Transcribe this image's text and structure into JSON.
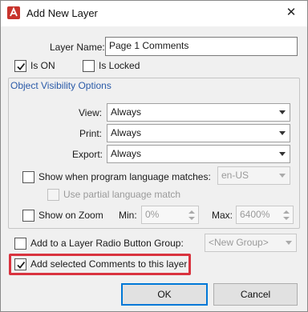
{
  "window": {
    "title": "Add New Layer",
    "close_glyph": "✕",
    "icon": "app-logo-icon"
  },
  "layer_name": {
    "label": "Layer Name:",
    "value": "Page 1 Comments"
  },
  "is_on": {
    "label": "Is ON",
    "checked": true
  },
  "is_locked": {
    "label": "Is Locked",
    "checked": false
  },
  "visibility": {
    "group_title": "Object Visibility Options",
    "view": {
      "label": "View:",
      "value": "Always"
    },
    "print": {
      "label": "Print:",
      "value": "Always"
    },
    "export": {
      "label": "Export:",
      "value": "Always"
    },
    "language": {
      "label": "Show when program language matches:",
      "value": "en-US",
      "checked": false
    },
    "partial_language": {
      "label": "Use partial language match",
      "checked": false
    },
    "zoom": {
      "label": "Show on Zoom",
      "checked": false,
      "min_label": "Min:",
      "min_value": "0%",
      "max_label": "Max:",
      "max_value": "6400%"
    }
  },
  "radio_group": {
    "label": "Add to a Layer Radio Button Group:",
    "value": "<New Group>",
    "checked": false
  },
  "add_comments": {
    "label": "Add selected Comments to this layer",
    "checked": true,
    "highlight_color": "#d9333f"
  },
  "buttons": {
    "ok": "OK",
    "cancel": "Cancel"
  },
  "colors": {
    "accent": "#0078d7",
    "group_title": "#2a5aa8"
  }
}
